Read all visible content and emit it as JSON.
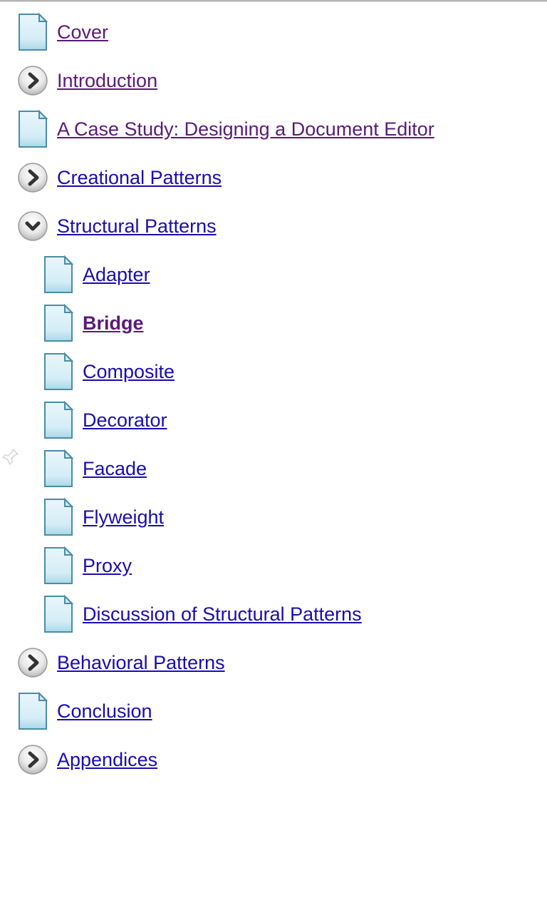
{
  "toc": {
    "items": [
      {
        "label": "Cover",
        "icon": "page",
        "visited": true,
        "bold": false,
        "child": false
      },
      {
        "label": "Introduction",
        "icon": "expand-right",
        "visited": true,
        "bold": false,
        "child": false
      },
      {
        "label": "A Case Study: Designing a Document Editor",
        "icon": "page",
        "visited": true,
        "bold": false,
        "child": false
      },
      {
        "label": "Creational Patterns",
        "icon": "expand-right",
        "visited": false,
        "bold": false,
        "child": false
      },
      {
        "label": "Structural Patterns",
        "icon": "expand-down",
        "visited": false,
        "bold": false,
        "child": false
      },
      {
        "label": "Adapter",
        "icon": "page",
        "visited": false,
        "bold": false,
        "child": true
      },
      {
        "label": "Bridge",
        "icon": "page",
        "visited": true,
        "bold": true,
        "child": true
      },
      {
        "label": "Composite",
        "icon": "page",
        "visited": false,
        "bold": false,
        "child": true
      },
      {
        "label": "Decorator",
        "icon": "page",
        "visited": false,
        "bold": false,
        "child": true
      },
      {
        "label": "Facade",
        "icon": "page",
        "visited": false,
        "bold": false,
        "child": true
      },
      {
        "label": "Flyweight",
        "icon": "page",
        "visited": false,
        "bold": false,
        "child": true
      },
      {
        "label": "Proxy",
        "icon": "page",
        "visited": false,
        "bold": false,
        "child": true
      },
      {
        "label": "Discussion of Structural Patterns",
        "icon": "page",
        "visited": false,
        "bold": false,
        "child": true
      },
      {
        "label": "Behavioral Patterns",
        "icon": "expand-right",
        "visited": false,
        "bold": false,
        "child": false
      },
      {
        "label": "Conclusion",
        "icon": "page",
        "visited": false,
        "bold": false,
        "child": false
      },
      {
        "label": "Appendices",
        "icon": "expand-right",
        "visited": false,
        "bold": false,
        "child": false
      }
    ]
  }
}
